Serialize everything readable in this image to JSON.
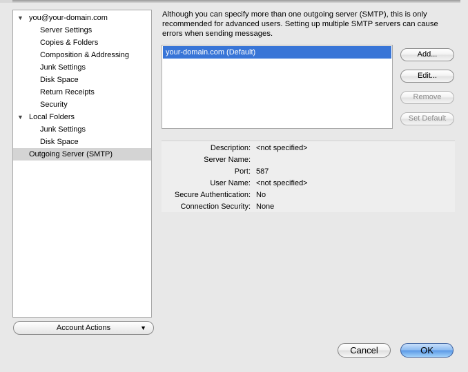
{
  "sidebar": {
    "items": [
      {
        "label": "you@your-domain.com",
        "level": 0,
        "expanded": true
      },
      {
        "label": "Server Settings",
        "level": 1
      },
      {
        "label": "Copies & Folders",
        "level": 1
      },
      {
        "label": "Composition & Addressing",
        "level": 1
      },
      {
        "label": "Junk Settings",
        "level": 1
      },
      {
        "label": "Disk Space",
        "level": 1
      },
      {
        "label": "Return Receipts",
        "level": 1
      },
      {
        "label": "Security",
        "level": 1
      },
      {
        "label": "Local Folders",
        "level": 0,
        "expanded": true
      },
      {
        "label": "Junk Settings",
        "level": 1
      },
      {
        "label": "Disk Space",
        "level": 1
      },
      {
        "label": "Outgoing Server (SMTP)",
        "level": 0,
        "selected": true
      }
    ],
    "disclosure_glyph": "▼"
  },
  "account_actions": {
    "label": "Account Actions",
    "arrow": "▼"
  },
  "main": {
    "description": "Although you can specify more than one outgoing server (SMTP), this is only recommended for advanced users. Setting up multiple SMTP servers can cause errors when sending messages.",
    "servers": [
      "your-domain.com (Default)"
    ],
    "buttons": {
      "add": "Add...",
      "edit": "Edit...",
      "remove": "Remove",
      "set_default": "Set Default"
    },
    "details": [
      {
        "label": "Description:",
        "value": "<not specified>"
      },
      {
        "label": "Server Name:",
        "value": ""
      },
      {
        "label": "Port:",
        "value": "587"
      },
      {
        "label": "User Name:",
        "value": "<not specified>"
      },
      {
        "label": "Secure Authentication:",
        "value": "No"
      },
      {
        "label": "Connection Security:",
        "value": "None"
      }
    ]
  },
  "footer": {
    "cancel": "Cancel",
    "ok": "OK"
  },
  "colors": {
    "selection": "#3875d7",
    "sidebar_selected": "#d4d4d4",
    "default_button": "#5a98e6"
  }
}
